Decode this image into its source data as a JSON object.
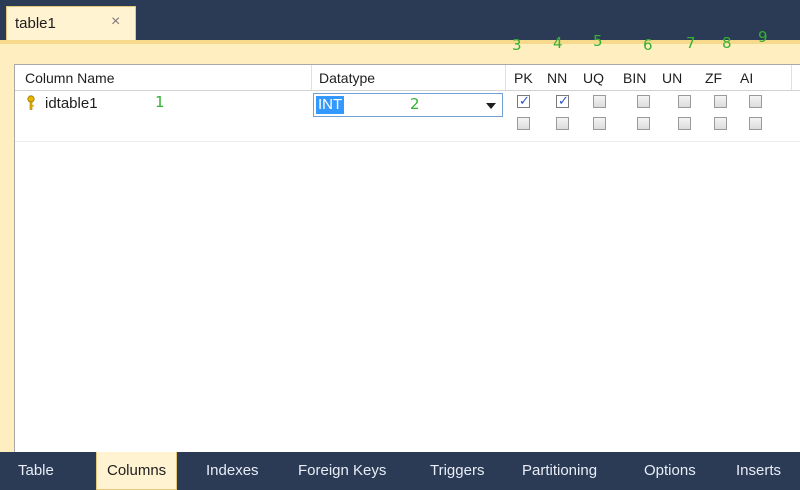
{
  "document_tab": {
    "title": "table1",
    "close_glyph": "×"
  },
  "annotations": [
    "1",
    "2",
    "3",
    "4",
    "5",
    "6",
    "7",
    "8",
    "9"
  ],
  "grid": {
    "headers": {
      "column_name": "Column Name",
      "datatype": "Datatype",
      "flags": [
        "PK",
        "NN",
        "UQ",
        "BIN",
        "UN",
        "ZF",
        "AI"
      ]
    },
    "rows": [
      {
        "column_name": "idtable1",
        "icon": "primary-key-icon",
        "datatype": "INT",
        "flags": [
          true,
          true,
          false,
          false,
          false,
          false,
          false
        ]
      },
      {
        "column_name": "",
        "datatype": "",
        "flags": [
          false,
          false,
          false,
          false,
          false,
          false,
          false
        ]
      }
    ]
  },
  "bottom_tabs": [
    "Table",
    "Columns",
    "Indexes",
    "Foreign Keys",
    "Triggers",
    "Partitioning",
    "Options",
    "Inserts"
  ],
  "active_bottom_tab": "Columns",
  "colors": {
    "chrome": "#2b3a55",
    "panel": "#ffeebf",
    "annotation": "#33b233",
    "selection": "#3399ff"
  }
}
